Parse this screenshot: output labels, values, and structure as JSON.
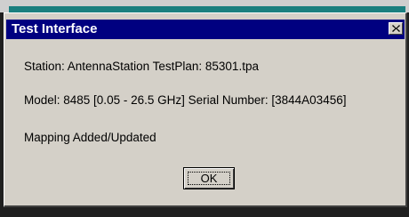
{
  "window": {
    "title": "Test Interface",
    "close_icon": "close-icon"
  },
  "body": {
    "line1": "Station: AntennaStation  TestPlan: 85301.tpa",
    "line2": "Model: 8485 [0.05 - 26.5 GHz] Serial Number: [3844A03456]",
    "line3": "Mapping Added/Updated"
  },
  "buttons": {
    "ok_label": "OK"
  },
  "colors": {
    "title_bar": "#000080",
    "dialog_face": "#d4d0c8",
    "title_text": "#ffffff"
  }
}
